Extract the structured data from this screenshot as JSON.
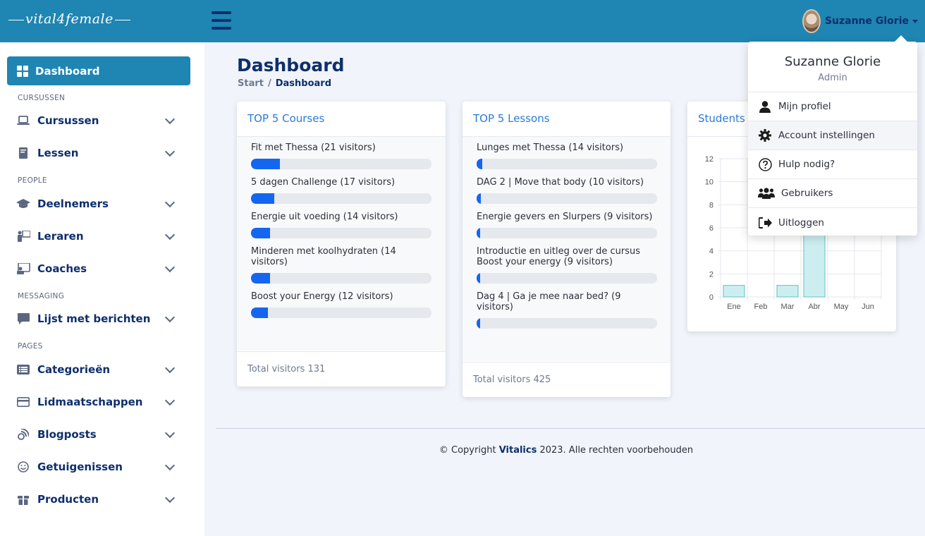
{
  "app": {
    "logo_text": "vital4female"
  },
  "user": {
    "name": "Suzanne Glorie",
    "role": "Admin"
  },
  "user_menu": [
    {
      "label": "Mijn profiel",
      "icon": "user-icon"
    },
    {
      "label": "Account instellingen",
      "icon": "gear-icon"
    },
    {
      "label": "Hulp nodig?",
      "icon": "question-icon"
    },
    {
      "label": "Gebruikers",
      "icon": "users-icon"
    },
    {
      "label": "Uitloggen",
      "icon": "logout-icon"
    }
  ],
  "sidebar": {
    "active": {
      "label": "Dashboard",
      "icon": "dashboard-icon"
    },
    "sections": [
      "CURSUSSEN",
      "PEOPLE",
      "MESSAGING",
      "PAGES"
    ],
    "items": [
      {
        "label": "Cursussen",
        "icon": "laptop-icon"
      },
      {
        "label": "Lessen",
        "icon": "book-icon"
      },
      {
        "label": "Deelnemers",
        "icon": "graduation-cap-icon"
      },
      {
        "label": "Leraren",
        "icon": "teacher-icon"
      },
      {
        "label": "Coaches",
        "icon": "coach-icon"
      },
      {
        "label": "Lijst met berichten",
        "icon": "message-icon"
      },
      {
        "label": "Categorieën",
        "icon": "list-icon"
      },
      {
        "label": "Lidmaatschappen",
        "icon": "membership-icon"
      },
      {
        "label": "Blogposts",
        "icon": "blog-icon"
      },
      {
        "label": "Getuigenissen",
        "icon": "smile-icon"
      },
      {
        "label": "Producten",
        "icon": "gift-icon"
      }
    ]
  },
  "page": {
    "title": "Dashboard",
    "breadcrumb": {
      "start": "Start",
      "separator": "/",
      "current": "Dashboard"
    }
  },
  "top_courses": {
    "title": "TOP 5 Courses",
    "items": [
      {
        "label": "Fit met Thessa (21 visitors)",
        "fraction": 0.16
      },
      {
        "label": "5 dagen Challenge (17 visitors)",
        "fraction": 0.13
      },
      {
        "label": "Energie uit voeding (14 visitors)",
        "fraction": 0.107
      },
      {
        "label": "Minderen met koolhydraten (14 visitors)",
        "fraction": 0.107
      },
      {
        "label": "Boost your Energy (12 visitors)",
        "fraction": 0.092
      }
    ],
    "total": "Total visitors 131"
  },
  "top_lessons": {
    "title": "TOP 5 Lessons",
    "items": [
      {
        "label": "Lunges met Thessa (14 visitors)",
        "fraction": 0.033
      },
      {
        "label": "DAG 2 | Move that body (10 visitors)",
        "fraction": 0.024
      },
      {
        "label": "Energie gevers en Slurpers (9 visitors)",
        "fraction": 0.021
      },
      {
        "label": "Introductie en uitleg over de cursus Boost your energy (9 visitors)",
        "fraction": 0.021
      },
      {
        "label": "Dag 4 | Ga je mee naar bed? (9 visitors)",
        "fraction": 0.021
      }
    ],
    "total": "Total visitors 425"
  },
  "students_card": {
    "title": "Students"
  },
  "chart_data": {
    "type": "bar",
    "title": "",
    "categories": [
      "Ene",
      "Feb",
      "Mar",
      "Abr",
      "May",
      "Jun"
    ],
    "values": [
      1,
      0,
      1,
      7,
      0,
      0
    ],
    "ylim": [
      0,
      12
    ],
    "yticks": [
      0,
      2,
      4,
      6,
      8,
      10,
      12
    ],
    "grid": true,
    "bar_color": "#cdeef0",
    "bar_stroke": "#5cc3c6"
  },
  "footer": {
    "prefix": "© Copyright ",
    "brand": "Vitalics",
    "suffix": " 2023. Alle rechten voorbehouden"
  },
  "colors": {
    "primary": "#1f85b2",
    "navy": "#0e2f6b",
    "progress": "#1466f0",
    "link": "#2b7bd8"
  }
}
